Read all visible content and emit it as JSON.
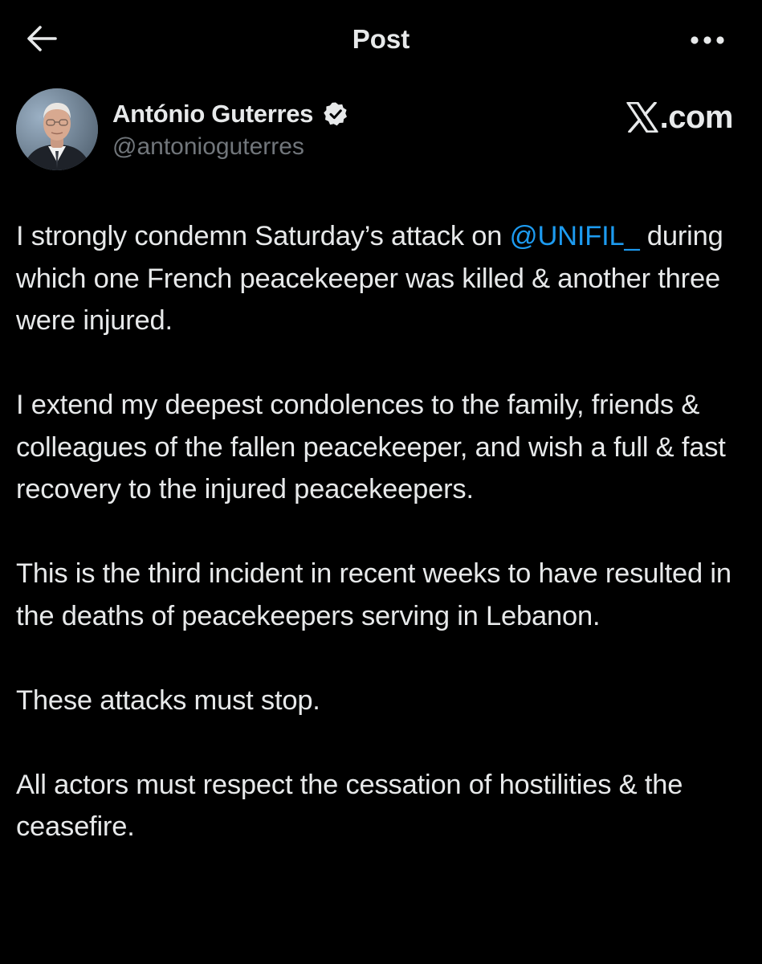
{
  "header": {
    "title": "Post",
    "back_icon": "arrow-left-icon",
    "more_icon": "more-horizontal-icon"
  },
  "author": {
    "display_name": "António Guterres",
    "handle": "@antonioguterres",
    "verified": true,
    "verified_icon": "verified-badge-icon",
    "badge_color": "#e7e9ea"
  },
  "brand": {
    "label": ".com",
    "icon": "x-logo-icon"
  },
  "post": {
    "p1_before": "I strongly condemn Saturday’s attack on ",
    "p1_mention": "@UNIFIL_",
    "p1_after": " during which one French peacekeeper was killed & another three were injured.",
    "p2": "I extend my deepest condolences to the family, friends & colleagues of the fallen peacekeeper, and wish a full & fast recovery to the injured peacekeepers.",
    "p3": "This is the third incident in recent weeks to have resulted in the deaths of peacekeepers serving in Lebanon.",
    "p4": "These attacks must stop.",
    "p5": "All actors must respect the cessation of hostilities & the ceasefire."
  },
  "colors": {
    "background": "#000000",
    "text": "#e7e9ea",
    "secondary_text": "#71767b",
    "link": "#1d9bf0"
  }
}
